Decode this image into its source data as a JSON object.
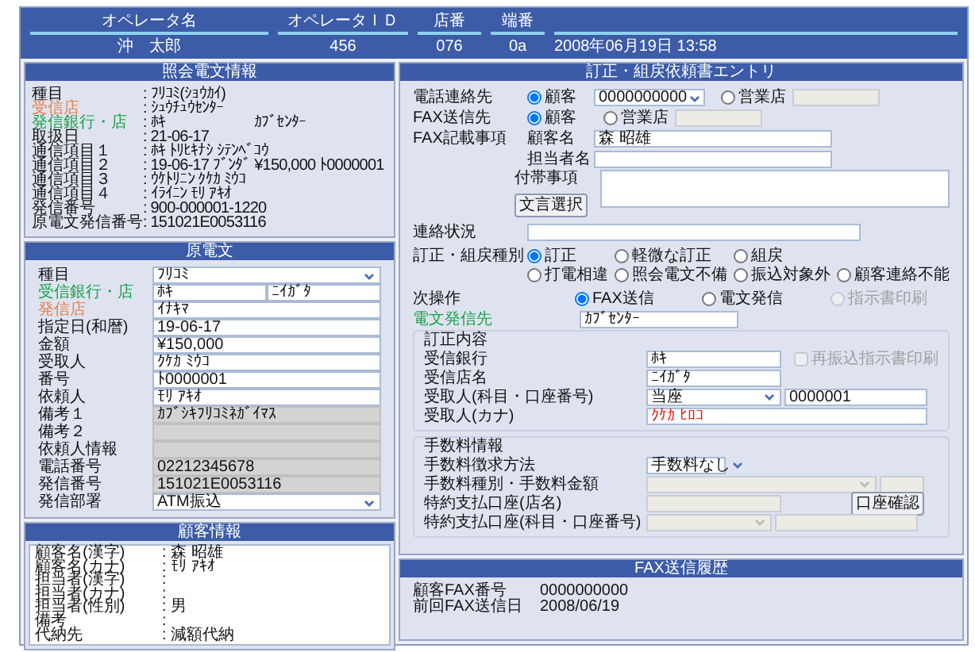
{
  "header": {
    "columns": [
      {
        "label": "オペレータ名",
        "value": "沖　太郎"
      },
      {
        "label": "オペレータＩＤ",
        "value": "456"
      },
      {
        "label": "店番",
        "value": "076"
      },
      {
        "label": "端番",
        "value": "0a"
      },
      {
        "value": "2008年06月19日 13:58"
      }
    ]
  },
  "inquiry": {
    "title": "照会電文情報",
    "rows": [
      {
        "label": "種目",
        "value": ": ﾌﾘｺﾐ(ｼｮｳｶｲ)"
      },
      {
        "label": "受信店",
        "value": ": ｼｭｳﾁｭｳｾﾝﾀｰ",
        "color": "#e8804a"
      },
      {
        "label": "発信銀行・店",
        "value": ": ﾎｷ",
        "value_2": "ｶﾌﾞｾﾝﾀｰ",
        "color": "#1aa34a"
      },
      {
        "label": "取扱日",
        "value": ": 21-06-17"
      },
      {
        "label": "通信項目１",
        "value": ": ﾎｷ ﾄﾘﾋｷﾅｼ ｼﾃﾝﾍﾞｺｳ"
      },
      {
        "label": "通信項目２",
        "value": ": 19-06-17 ﾌﾞﾝﾀﾞ ¥150,000 ﾄ0000001"
      },
      {
        "label": "通信項目３",
        "value": ": ｳｹﾄﾘﾆﾝ ｸｹｶ ﾐｳｺ"
      },
      {
        "label": "通信項目４",
        "value": ": ｲﾗｲﾆﾝ ﾓﾘ ｱｷｵ"
      },
      {
        "label": "発信番号",
        "value": ": 900-000001-1220"
      },
      {
        "label": "原電文発信番号",
        "value": ": 151021E0053116"
      }
    ]
  },
  "original": {
    "title": "原電文",
    "rows": [
      {
        "label": "種目",
        "kind": "select",
        "value": "ﾌﾘｺﾐ"
      },
      {
        "label": "受信銀行・店",
        "kind": "pair",
        "value": "ﾎｷ",
        "value_2": "ﾆｲｶﾞﾀ",
        "color": "#1aa34a"
      },
      {
        "label": "発信店",
        "kind": "text",
        "value": "ｲﾅｷﾏ",
        "color": "#e8804a"
      },
      {
        "label": "指定日(和暦)",
        "kind": "text",
        "value": "19-06-17"
      },
      {
        "label": "金額",
        "kind": "text",
        "value": "¥150,000"
      },
      {
        "label": "受取人",
        "kind": "text",
        "value": "ｸｹｶ ﾐｳｺ"
      },
      {
        "label": "番号",
        "kind": "text",
        "value": "ﾄ0000001"
      },
      {
        "label": "依頼人",
        "kind": "text",
        "value": "ﾓﾘ ｱｷｵ"
      },
      {
        "label": "備考１",
        "kind": "readonly",
        "value": "ｶﾌﾞｼｷﾌﾘｺﾐﾈｶﾞｲﾏｽ"
      },
      {
        "label": "備考２",
        "kind": "readonly"
      },
      {
        "label": "依頼人情報",
        "kind": "readonly"
      },
      {
        "label": "電話番号",
        "kind": "readonly",
        "value": "02212345678"
      },
      {
        "label": "発信番号",
        "kind": "readonly",
        "value": "151021E0053116"
      },
      {
        "label": "発信部署",
        "kind": "select",
        "value": "ATM振込"
      }
    ]
  },
  "customer": {
    "title": "顧客情報",
    "lines": [
      {
        "label": "顧客名(漢字)",
        "value": ": 森 昭雄"
      },
      {
        "label": "顧客名(カナ)",
        "value": ": ﾓﾘ ｱｷｵ"
      },
      {
        "label": "担当者(漢字)",
        "value": ":"
      },
      {
        "label": "担当者(カナ)",
        "value": ":"
      },
      {
        "label": "担当者(性別)",
        "value": ": 男"
      },
      {
        "label": "備考",
        "value": ":"
      },
      {
        "label": "代納先",
        "value": ": 減額代納"
      }
    ]
  },
  "entry": {
    "title": "訂正・組戻依頼書エントリ",
    "phone": {
      "label": "電話連絡先",
      "number": "0000000000",
      "options": [
        {
          "label": "顧客",
          "selected": true
        },
        {
          "label": "営業店",
          "selected": false
        }
      ]
    },
    "fax_to": {
      "label": "FAX送信先",
      "options": [
        {
          "label": "顧客",
          "selected": true
        },
        {
          "label": "営業店",
          "selected": false
        }
      ]
    },
    "fax_items": {
      "label": "FAX記載事項",
      "customer_label": "顧客名",
      "customer_value": "森 昭雄",
      "staff_label": "担当者名",
      "note_label": "付帯事項",
      "button": "文言選択"
    },
    "contact": {
      "label": "連絡状況"
    },
    "type": {
      "label": "訂正・組戻種別",
      "options": [
        {
          "label": "訂正",
          "selected": true
        },
        {
          "label": "軽微な訂正",
          "selected": false
        },
        {
          "label": "組戻",
          "selected": false
        },
        {
          "label": "打電相違",
          "selected": false
        },
        {
          "label": "照会電文不備",
          "selected": false
        },
        {
          "label": "振込対象外",
          "selected": false
        },
        {
          "label": "顧客連絡不能",
          "selected": false
        }
      ]
    },
    "next": {
      "label": "次操作",
      "options": [
        {
          "label": "FAX送信",
          "selected": true,
          "disabled": false
        },
        {
          "label": "電文発信",
          "selected": false,
          "disabled": false
        },
        {
          "label": "指示書印刷",
          "selected": false,
          "disabled": true
        }
      ]
    },
    "destination": {
      "label": "電文発信先",
      "value": "ｶﾌﾞｾﾝﾀｰ"
    },
    "correction": {
      "title": "訂正内容",
      "bank_label": "受信銀行",
      "bank": "ﾎｷ",
      "reprint": {
        "label": "再振込指示書印刷",
        "checked": false,
        "disabled": true
      },
      "branch_label": "受信店名",
      "branch": "ﾆｲｶﾞﾀ",
      "account_label": "受取人(科目・口座番号)",
      "account_type": "当座",
      "account_number": "0000001",
      "payee_label": "受取人(カナ)",
      "payee": "ｸｹｶ ﾋﾛｺ"
    },
    "fees": {
      "title": "手数料情報",
      "method_label": "手数料徴求方法",
      "method": "手数料なし",
      "kind_label": "手数料種別・手数料金額",
      "branch_label": "特約支払口座(店名)",
      "confirm_button": "口座確認",
      "account_label": "特約支払口座(科目・口座番号)"
    }
  },
  "fax_history": {
    "title": "FAX送信履歴",
    "rows": [
      {
        "label": "顧客FAX番号",
        "value": "0000000000"
      },
      {
        "label": "前回FAX送信日",
        "value": "2008/06/19"
      }
    ]
  }
}
